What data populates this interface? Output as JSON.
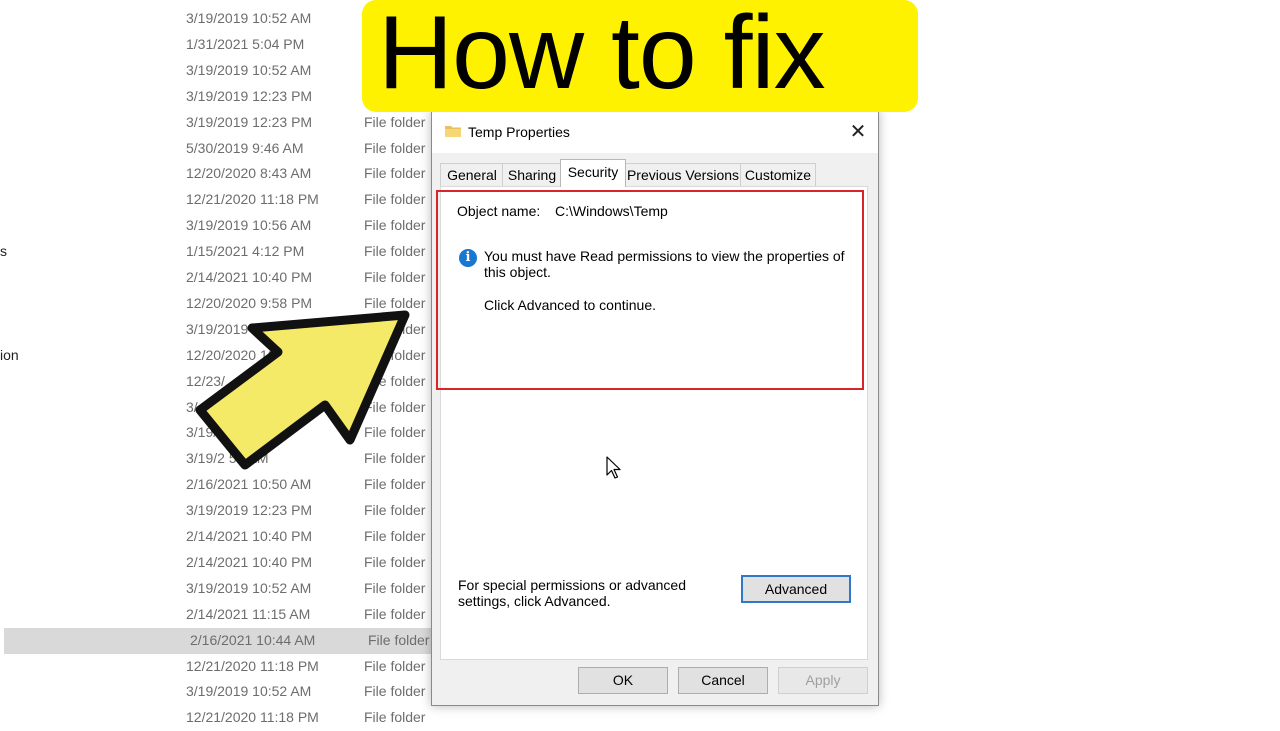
{
  "explorer": {
    "left_fragments": [
      "s",
      "ion"
    ],
    "rows": [
      {
        "date": "3/19/2019 10:52 AM",
        "type": ""
      },
      {
        "date": "1/31/2021 5:04 PM",
        "type": ""
      },
      {
        "date": "3/19/2019 10:52 AM",
        "type": ""
      },
      {
        "date": "3/19/2019 12:23 PM",
        "type": ""
      },
      {
        "date": "3/19/2019 12:23 PM",
        "type": "File folder"
      },
      {
        "date": "5/30/2019 9:46 AM",
        "type": "File folder"
      },
      {
        "date": "12/20/2020 8:43 AM",
        "type": "File folder"
      },
      {
        "date": "12/21/2020 11:18 PM",
        "type": "File folder"
      },
      {
        "date": "3/19/2019 10:56 AM",
        "type": "File folder"
      },
      {
        "date": "1/15/2021 4:12 PM",
        "type": "File folder"
      },
      {
        "date": "2/14/2021 10:40 PM",
        "type": "File folder"
      },
      {
        "date": "12/20/2020 9:58 PM",
        "type": "File folder"
      },
      {
        "date": "3/19/2019 10:5",
        "type": "File folder"
      },
      {
        "date": "12/20/2020 10:5",
        "type": "File folder"
      },
      {
        "date": "12/23/",
        "type": "File folder"
      },
      {
        "date": "3/",
        "type": "File folder"
      },
      {
        "date": "3/19/      AM",
        "type": "File folder"
      },
      {
        "date": "3/19/2  52 AM",
        "type": "File folder"
      },
      {
        "date": "2/16/2021 10:50 AM",
        "type": "File folder"
      },
      {
        "date": "3/19/2019 12:23 PM",
        "type": "File folder"
      },
      {
        "date": "2/14/2021 10:40 PM",
        "type": "File folder"
      },
      {
        "date": "2/14/2021 10:40 PM",
        "type": "File folder"
      },
      {
        "date": "3/19/2019 10:52 AM",
        "type": "File folder"
      },
      {
        "date": "2/14/2021 11:15 AM",
        "type": "File folder"
      },
      {
        "date": "2/16/2021 10:44 AM",
        "type": "File folder",
        "selected": true
      },
      {
        "date": "12/21/2020 11:18 PM",
        "type": "File folder"
      },
      {
        "date": "3/19/2019 10:52 AM",
        "type": "File folder"
      },
      {
        "date": "12/21/2020 11:18 PM",
        "type": "File folder"
      }
    ]
  },
  "dialog": {
    "title": "Temp Properties",
    "close_glyph": "✕",
    "tabs": [
      "General",
      "Sharing",
      "Security",
      "Previous Versions",
      "Customize"
    ],
    "active_tab": "Security",
    "object_name_label": "Object name:",
    "object_name_value": "C:\\Windows\\Temp",
    "info_icon_glyph": "i",
    "info_message": "You must have Read permissions to view the properties of this object.",
    "continue_message": "Click Advanced to continue.",
    "special_permissions_text": "For special permissions or advanced settings, click Advanced.",
    "advanced_button": "Advanced",
    "ok_button": "OK",
    "cancel_button": "Cancel",
    "apply_button": "Apply"
  },
  "overlay": {
    "banner_text": "How to fix",
    "banner_color": "#fff200",
    "arrow_color": "#f5ea68",
    "highlight_color": "#d9242b"
  }
}
